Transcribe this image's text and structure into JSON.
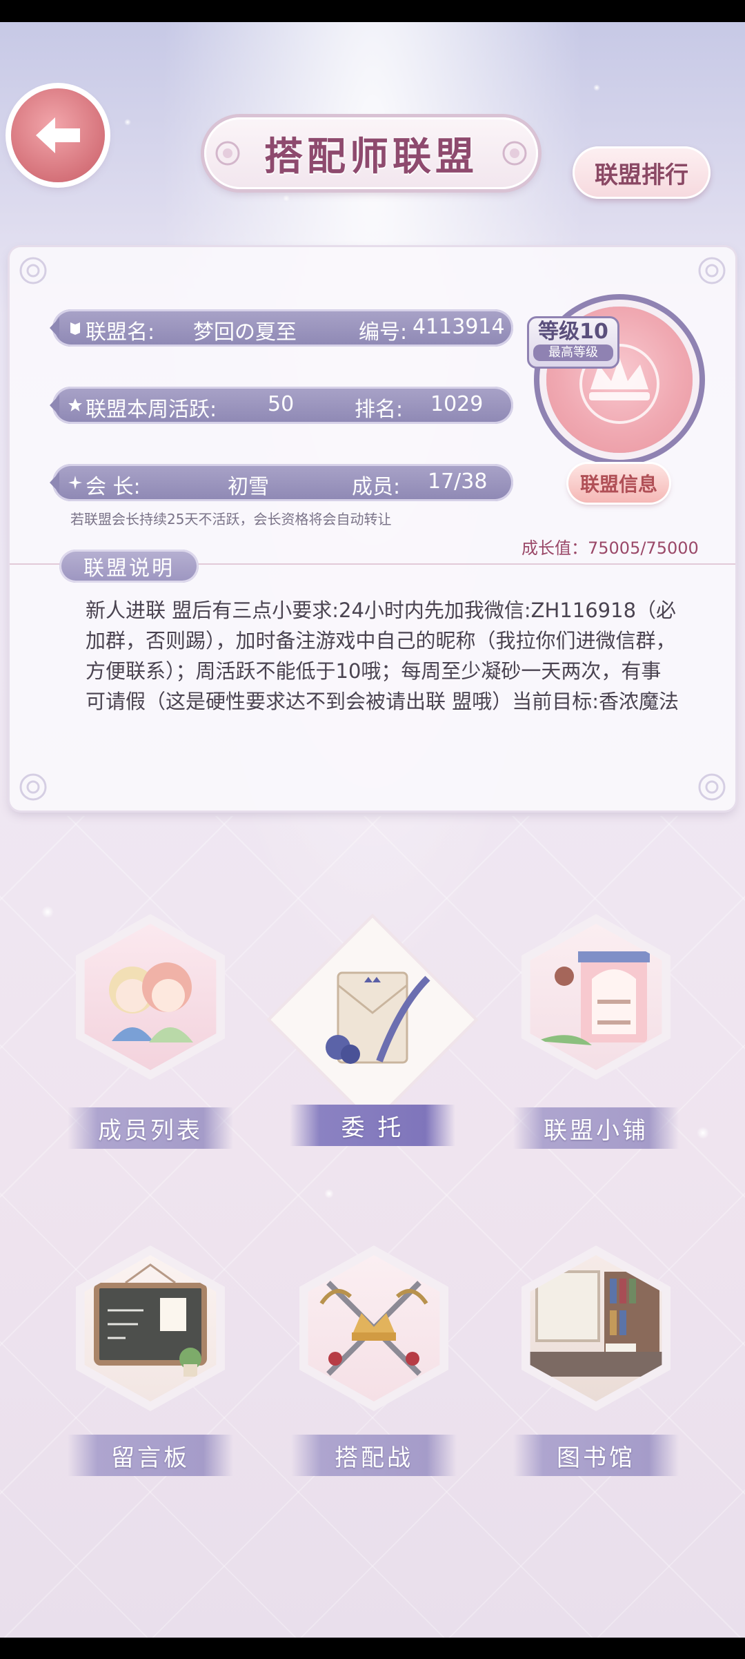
{
  "header": {
    "title": "搭配师联盟",
    "rank_button": "联盟排行"
  },
  "info": {
    "name_label": "联盟名:",
    "name_value": "梦回の夏至",
    "id_label": "编号:",
    "id_value": "4113914",
    "activity_label": "联盟本周活跃:",
    "activity_value": "50",
    "rank_label": "排名:",
    "rank_value": "1029",
    "leader_label": "会    长:",
    "leader_value": "初雪",
    "members_label": "成员:",
    "members_value": "17/38",
    "level": "等级10",
    "level_max": "最高等级",
    "info_button": "联盟信息",
    "hint": "若联盟会长持续25天不活跃，会长资格将会自动转让",
    "growth_label": "成长值：",
    "growth_value": "75005/75000"
  },
  "description": {
    "tab": "联盟说明",
    "text": "新人进联 盟后有三点小要求:24小时内先加我微信:ZH116918（必加群，否则踢），加时备注游戏中自己的昵称（我拉你们进微信群，方便联系）；周活跃不能低于10哦；每周至少凝砂一天两次，有事可请假（这是硬性要求达不到会被请出联 盟哦）当前目标:香浓魔法"
  },
  "menu": {
    "members": "成员列表",
    "commission": "委  托",
    "shop": "联盟小铺",
    "board": "留言板",
    "battle": "搭配战",
    "library": "图书馆"
  },
  "colors": {
    "accent": "#8e88b4",
    "title": "#8e4a6e",
    "pink_button": "#f5b8b6"
  }
}
